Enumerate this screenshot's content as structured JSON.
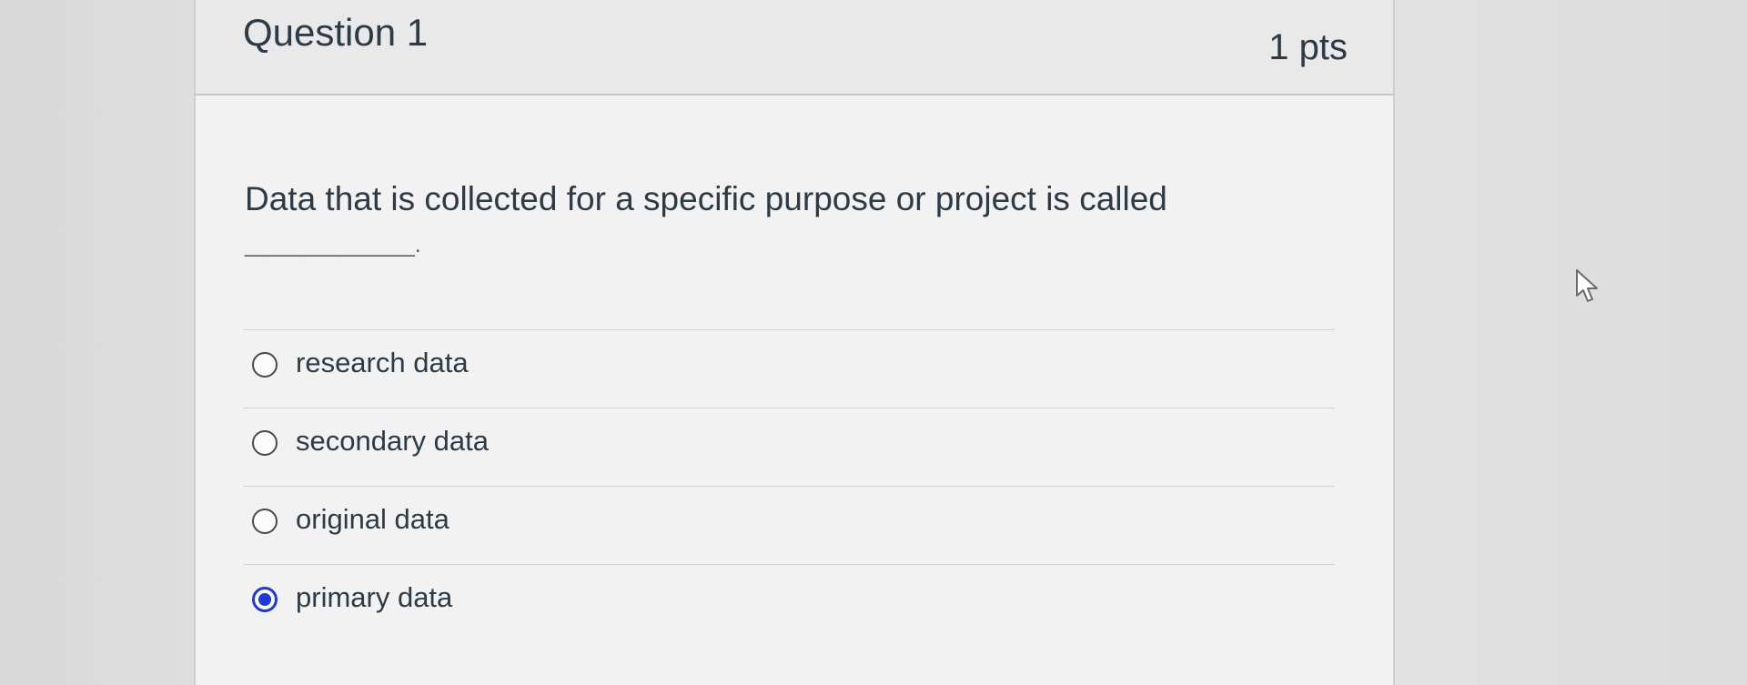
{
  "question": {
    "title": "Question 1",
    "points": "1 pts",
    "text": "Data that is collected for a specific purpose or project is called",
    "blank": "______________."
  },
  "answers": [
    {
      "label": "research data",
      "selected": false
    },
    {
      "label": "secondary data",
      "selected": false
    },
    {
      "label": "original data",
      "selected": false
    },
    {
      "label": "primary data",
      "selected": true
    }
  ],
  "colors": {
    "selected_radio": "#1f3ad6",
    "text": "#2d3b45"
  }
}
